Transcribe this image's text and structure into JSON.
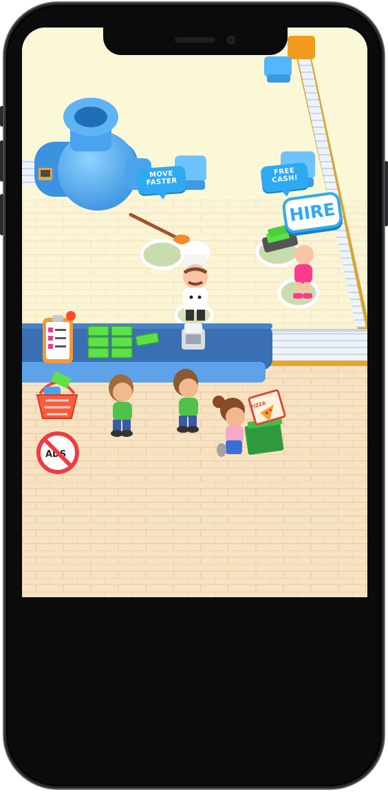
{
  "device": {
    "frame": "smartphone"
  },
  "game": {
    "bubbles": {
      "move_faster": {
        "line1": "MOVE",
        "line2": "FASTER",
        "color": "#2fa9f2"
      },
      "free_cash": {
        "line1": "FREE",
        "line2": "CASH!",
        "color": "#2fa9f2"
      }
    },
    "hire_button": {
      "label": "HIRE",
      "color": "#2fa9f2"
    },
    "side_buttons": {
      "tasks": {
        "icon": "clipboard-checklist-icon",
        "has_notification": true
      },
      "shop": {
        "icon": "shopping-basket-cash-icon"
      },
      "no_ads": {
        "icon": "no-ads-icon",
        "label": "ADS"
      }
    },
    "pizza_box": {
      "label": "PIZZA"
    },
    "colors": {
      "floor": "#fbf8d8",
      "tiles": "#f7e3c2",
      "counter": "#3a6fb3",
      "conveyor": "#e8eef6",
      "money": "#5ee04a"
    }
  }
}
